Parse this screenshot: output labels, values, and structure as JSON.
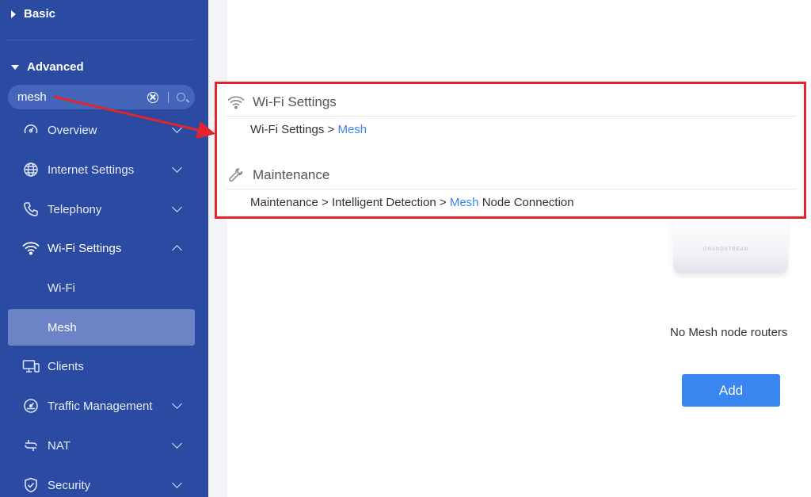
{
  "sidebar": {
    "basic_label": "Basic",
    "advanced_label": "Advanced",
    "search": {
      "value": "mesh"
    },
    "items": [
      {
        "label": "Overview",
        "icon": "gauge-icon"
      },
      {
        "label": "Internet Settings",
        "icon": "globe-icon"
      },
      {
        "label": "Telephony",
        "icon": "phone-icon"
      },
      {
        "label": "Wi-Fi Settings",
        "icon": "wifi-icon",
        "expanded": true
      },
      {
        "label": "Clients",
        "icon": "devices-icon"
      },
      {
        "label": "Traffic Management",
        "icon": "speedometer-icon"
      },
      {
        "label": "NAT",
        "icon": "nat-icon"
      },
      {
        "label": "Security",
        "icon": "shield-icon"
      }
    ],
    "subitems": [
      {
        "label": "Wi-Fi"
      },
      {
        "label": "Mesh",
        "active": true
      }
    ]
  },
  "main": {
    "device_brand": "GRANDSTREAM",
    "empty_text": "No Mesh node routers",
    "add_label": "Add"
  },
  "results": {
    "groups": [
      {
        "title": "Wi-Fi Settings",
        "icon": "wifi-icon",
        "path_prefix": "Wi-Fi Settings > ",
        "path_match": "Mesh",
        "path_suffix": ""
      },
      {
        "title": "Maintenance",
        "icon": "wrench-icon",
        "path_prefix": "Maintenance > Intelligent Detection > ",
        "path_match": "Mesh",
        "path_suffix": " Node Connection"
      }
    ]
  },
  "colors": {
    "sidebar_bg": "#2b4aa2",
    "active_item": "#6c84c6",
    "accent_blue": "#3a86f0",
    "highlight_red": "#e0262b"
  }
}
